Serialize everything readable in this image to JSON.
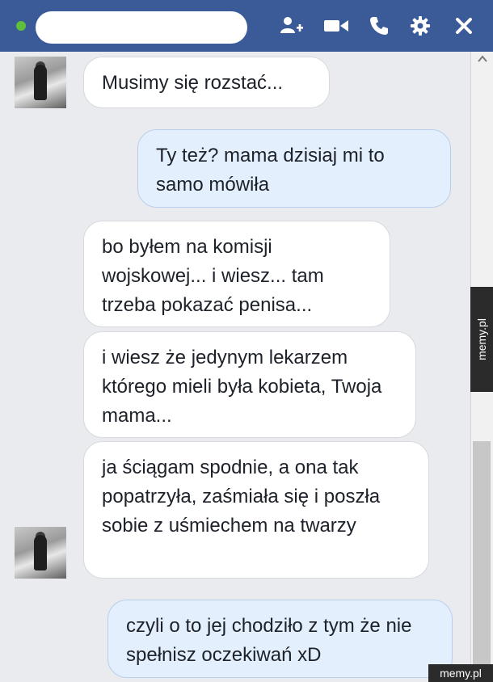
{
  "header": {
    "icons": [
      "add-person-icon",
      "video-camera-icon",
      "phone-icon",
      "gear-icon",
      "close-icon"
    ],
    "colors": {
      "bar": "#3a5a98",
      "online": "#5fbf3a"
    }
  },
  "messages": [
    {
      "side": "incoming",
      "text": "Musimy się rozstać..."
    },
    {
      "side": "outgoing",
      "text": "Ty też? mama dzisiaj mi to samo mówiła"
    },
    {
      "side": "incoming",
      "text": "bo byłem na komisji wojskowej... i wiesz... tam trzeba pokazać penisa..."
    },
    {
      "side": "incoming",
      "text": "i wiesz że jedynym lekarzem którego mieli była kobieta, Twoja mama..."
    },
    {
      "side": "incoming",
      "text": "ja ściągam spodnie, a ona tak popatrzyła, zaśmiała się i poszła sobie z uśmiechem na twarzy"
    },
    {
      "side": "outgoing",
      "text": "czyli o to jej chodziło z tym że nie spełnisz oczekiwań xD"
    }
  ],
  "watermark": {
    "side": "memy.pl",
    "corner": "memy.pl"
  },
  "colors": {
    "incoming_bubble": "#ffffff",
    "outgoing_bubble": "#e3effd"
  }
}
